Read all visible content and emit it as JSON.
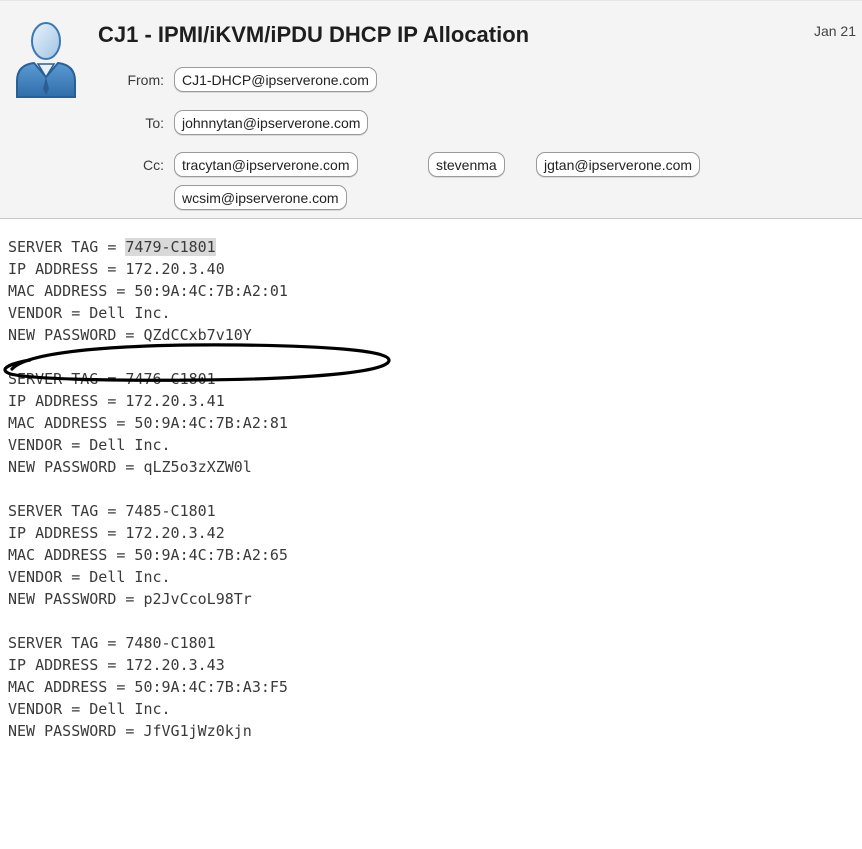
{
  "email": {
    "subject": "CJ1 - IPMI/iKVM/iPDU DHCP IP Allocation",
    "date": "Jan 21",
    "from_label": "From:",
    "from": "CJ1-DHCP@ipserverone.com",
    "to_label": "To:",
    "to": "johnnytan@ipserverone.com",
    "cc_label": "Cc:",
    "cc": [
      "tracytan@ipserverone.com",
      "stevenma",
      "jgtan@ipserverone.com",
      "wcsim@ipserverone.com"
    ],
    "avatar_icon": "user-avatar-icon"
  },
  "servers": [
    {
      "tag_line": "SERVER TAG = ",
      "tag": "7479-C1801",
      "ip_line": "IP ADDRESS = 172.20.3.40",
      "mac_line": "MAC ADDRESS = 50:9A:4C:7B:A2:01",
      "vendor_line": "VENDOR = Dell Inc.",
      "password_line": "NEW PASSWORD = QZdCCxb7v10Y"
    },
    {
      "tag_line": "SERVER TAG = ",
      "tag": "7476-C1801",
      "ip_line": "IP ADDRESS = 172.20.3.41",
      "mac_line": "MAC ADDRESS = 50:9A:4C:7B:A2:81",
      "vendor_line": "VENDOR = Dell Inc.",
      "password_line": "NEW PASSWORD = qLZ5o3zXZW0l"
    },
    {
      "tag_line": "SERVER TAG = ",
      "tag": "7485-C1801",
      "ip_line": "IP ADDRESS = 172.20.3.42",
      "mac_line": "MAC ADDRESS = 50:9A:4C:7B:A2:65",
      "vendor_line": "VENDOR = Dell Inc.",
      "password_line": "NEW PASSWORD = p2JvCcoL98Tr"
    },
    {
      "tag_line": "SERVER TAG = ",
      "tag": "7480-C1801",
      "ip_line": "IP ADDRESS = 172.20.3.43",
      "mac_line": "MAC ADDRESS = 50:9A:4C:7B:A3:F5",
      "vendor_line": "VENDOR = Dell Inc.",
      "password_line": "NEW PASSWORD = JfVG1jWz0kjn"
    }
  ]
}
